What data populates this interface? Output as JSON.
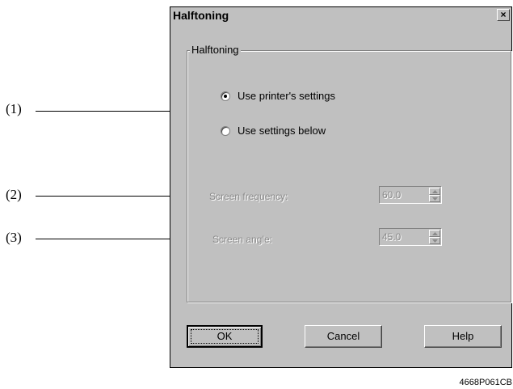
{
  "callouts": [
    "(1)",
    "(2)",
    "(3)"
  ],
  "dialog": {
    "title": "Halftoning",
    "close_symbol": "×",
    "group_label": "Halftoning",
    "radios": [
      {
        "label": "Use printer's settings",
        "checked": true
      },
      {
        "label": "Use settings below",
        "checked": false
      }
    ],
    "fields": [
      {
        "label": "Screen frequency:",
        "value": "60.0",
        "enabled": false
      },
      {
        "label": "Screen angle:",
        "value": "45.0",
        "enabled": false
      }
    ],
    "buttons": {
      "ok": "OK",
      "cancel": "Cancel",
      "help": "Help"
    }
  },
  "figure_id": "4668P061CB",
  "icons": {
    "close": "close-icon",
    "spin_up": "up-arrow-icon",
    "spin_down": "down-arrow-icon"
  }
}
